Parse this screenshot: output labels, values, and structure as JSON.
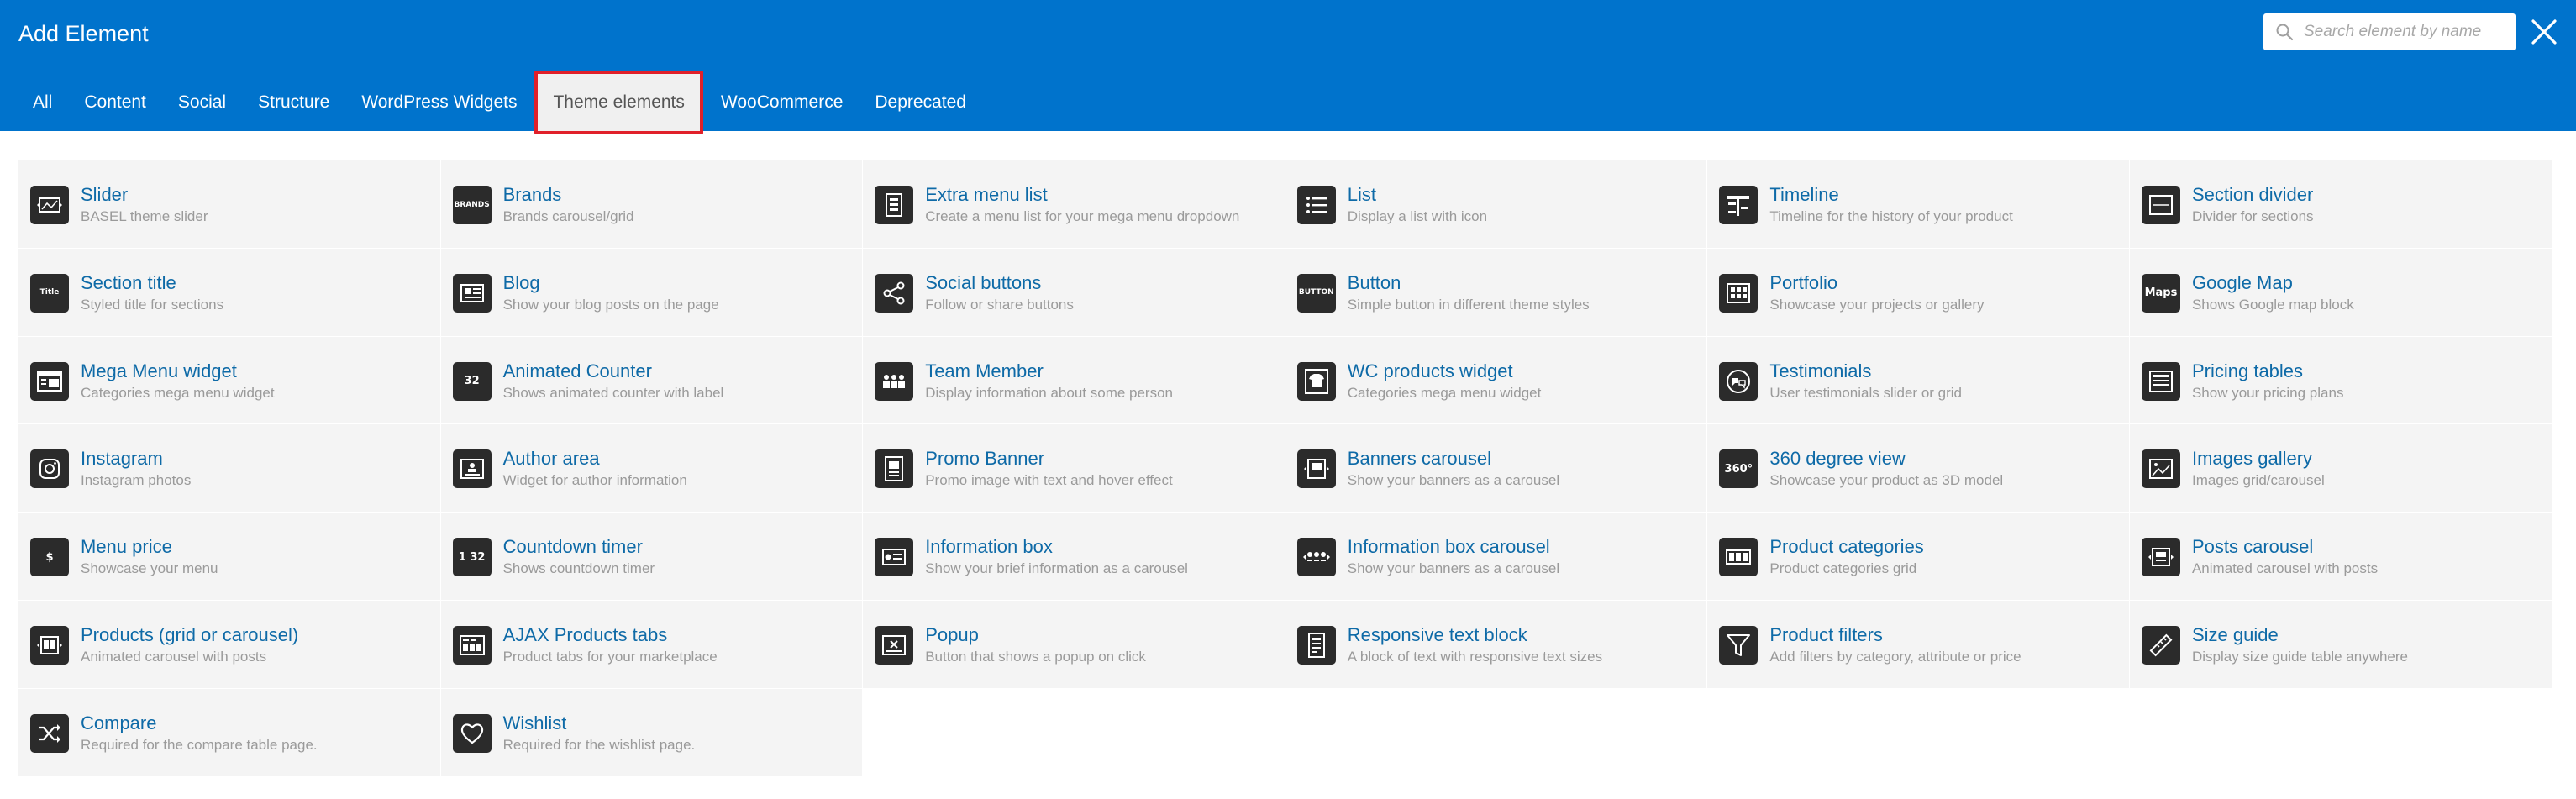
{
  "header": {
    "title": "Add Element",
    "search_placeholder": "Search element by name"
  },
  "tabs": [
    {
      "label": "All",
      "active": false
    },
    {
      "label": "Content",
      "active": false
    },
    {
      "label": "Social",
      "active": false
    },
    {
      "label": "Structure",
      "active": false
    },
    {
      "label": "WordPress Widgets",
      "active": false
    },
    {
      "label": "Theme elements",
      "active": true
    },
    {
      "label": "WooCommerce",
      "active": false
    },
    {
      "label": "Deprecated",
      "active": false
    }
  ],
  "colors": {
    "header_bg": "#0073cc",
    "link": "#0e6aa7",
    "card_bg": "#f4f4f4",
    "icon_bg": "#2b2b2b",
    "active_tab_border": "#e0202a"
  },
  "elements": [
    {
      "name": "Slider",
      "desc": "BASEL theme slider",
      "icon": "slider-icon"
    },
    {
      "name": "Brands",
      "desc": "Brands carousel/grid",
      "icon": "brands-icon",
      "glyph": "BRANDS"
    },
    {
      "name": "Extra menu list",
      "desc": "Create a menu list for your mega menu dropdown",
      "icon": "menu-list-icon"
    },
    {
      "name": "List",
      "desc": "Display a list with icon",
      "icon": "list-icon"
    },
    {
      "name": "Timeline",
      "desc": "Timeline for the history of your product",
      "icon": "timeline-icon"
    },
    {
      "name": "Section divider",
      "desc": "Divider for sections",
      "icon": "section-divider-icon"
    },
    {
      "name": "Section title",
      "desc": "Styled title for sections",
      "icon": "section-title-icon",
      "glyph": "Title"
    },
    {
      "name": "Blog",
      "desc": "Show your blog posts on the page",
      "icon": "blog-icon"
    },
    {
      "name": "Social buttons",
      "desc": "Follow or share buttons",
      "icon": "share-icon"
    },
    {
      "name": "Button",
      "desc": "Simple button in different theme styles",
      "icon": "button-icon",
      "glyph": "BUTTON"
    },
    {
      "name": "Portfolio",
      "desc": "Showcase your projects or gallery",
      "icon": "portfolio-icon"
    },
    {
      "name": "Google Map",
      "desc": "Shows Google map block",
      "icon": "map-pin-icon",
      "glyph": "Maps"
    },
    {
      "name": "Mega Menu widget",
      "desc": "Categories mega menu widget",
      "icon": "mega-menu-icon"
    },
    {
      "name": "Animated Counter",
      "desc": "Shows animated counter with label",
      "icon": "counter-icon",
      "glyph": "32"
    },
    {
      "name": "Team Member",
      "desc": "Display information about some person",
      "icon": "team-icon"
    },
    {
      "name": "WC products widget",
      "desc": "Categories mega menu widget",
      "icon": "tshirt-icon"
    },
    {
      "name": "Testimonials",
      "desc": "User testimonials slider or grid",
      "icon": "testimonials-icon"
    },
    {
      "name": "Pricing tables",
      "desc": "Show your pricing plans",
      "icon": "pricing-table-icon"
    },
    {
      "name": "Instagram",
      "desc": "Instagram photos",
      "icon": "instagram-icon"
    },
    {
      "name": "Author area",
      "desc": "Widget for author information",
      "icon": "author-icon"
    },
    {
      "name": "Promo Banner",
      "desc": "Promo image with text and hover effect",
      "icon": "promo-banner-icon"
    },
    {
      "name": "Banners carousel",
      "desc": "Show your banners as a carousel",
      "icon": "banners-carousel-icon"
    },
    {
      "name": "360 degree view",
      "desc": "Showcase your product as 3D model",
      "icon": "view-360-icon",
      "glyph": "360°"
    },
    {
      "name": "Images gallery",
      "desc": "Images grid/carousel",
      "icon": "gallery-icon"
    },
    {
      "name": "Menu price",
      "desc": "Showcase your menu",
      "icon": "menu-price-icon",
      "glyph": "$"
    },
    {
      "name": "Countdown timer",
      "desc": "Shows countdown timer",
      "icon": "countdown-icon",
      "glyph": "1 32"
    },
    {
      "name": "Information box",
      "desc": "Show your brief information as a carousel",
      "icon": "info-box-icon"
    },
    {
      "name": "Information box carousel",
      "desc": "Show your banners as a carousel",
      "icon": "info-carousel-icon"
    },
    {
      "name": "Product categories",
      "desc": "Product categories grid",
      "icon": "categories-icon"
    },
    {
      "name": "Posts carousel",
      "desc": "Animated carousel with posts",
      "icon": "posts-carousel-icon"
    },
    {
      "name": "Products (grid or carousel)",
      "desc": "Animated carousel with posts",
      "icon": "products-carousel-icon"
    },
    {
      "name": "AJAX Products tabs",
      "desc": "Product tabs for your marketplace",
      "icon": "ajax-tabs-icon"
    },
    {
      "name": "Popup",
      "desc": "Button that shows a popup on click",
      "icon": "popup-icon"
    },
    {
      "name": "Responsive text block",
      "desc": "A block of text with responsive text sizes",
      "icon": "responsive-text-icon"
    },
    {
      "name": "Product filters",
      "desc": "Add filters by category, attribute or price",
      "icon": "filter-icon"
    },
    {
      "name": "Size guide",
      "desc": "Display size guide table anywhere",
      "icon": "ruler-icon"
    },
    {
      "name": "Compare",
      "desc": "Required for the compare table page.",
      "icon": "shuffle-icon"
    },
    {
      "name": "Wishlist",
      "desc": "Required for the wishlist page.",
      "icon": "heart-icon"
    }
  ]
}
